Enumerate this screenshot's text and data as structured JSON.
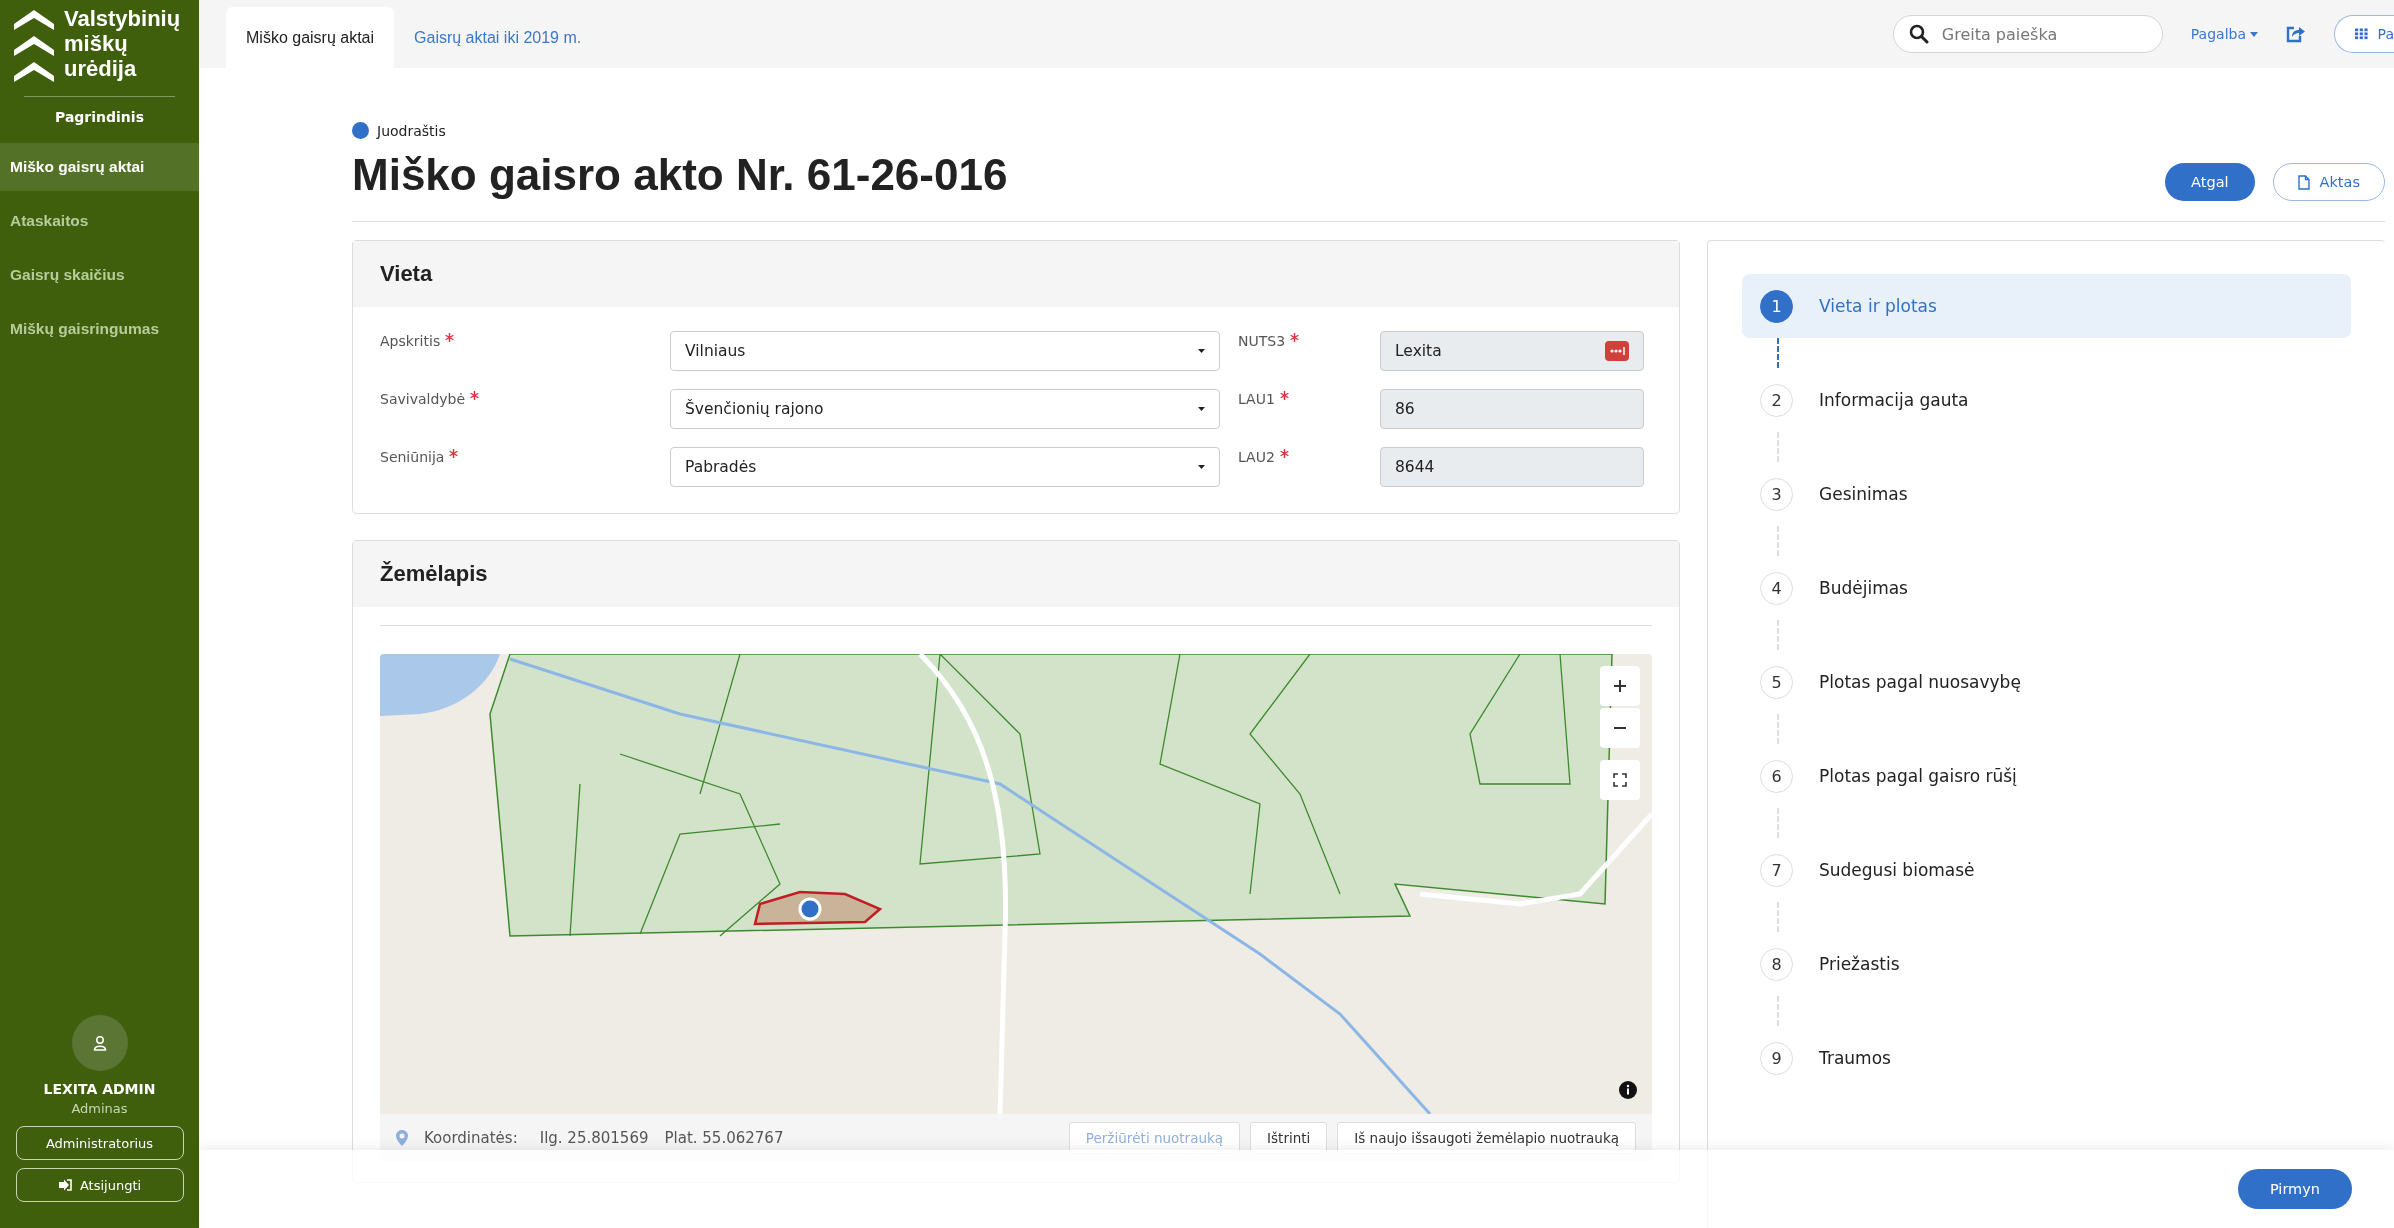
{
  "sidebar": {
    "logo_lines": [
      "Valstybinių",
      "miškų",
      "urėdija"
    ],
    "section": "Pagrindinis",
    "items": [
      {
        "label": "Miško gaisrų aktai",
        "selected": true
      },
      {
        "label": "Ataskaitos",
        "selected": false
      },
      {
        "label": "Gaisrų skaičius",
        "selected": false
      },
      {
        "label": "Miškų gaisringumas",
        "selected": false
      }
    ],
    "user": {
      "name": "LEXITA ADMIN",
      "role": "Adminas",
      "admin_button": "Administratorius",
      "logout_button": "Atsijungti"
    }
  },
  "top_tabs": [
    {
      "label": "Miško gaisrų aktai",
      "selected": true
    },
    {
      "label": "Gaisrų aktai iki 2019 m.",
      "selected": false
    }
  ],
  "search": {
    "placeholder": "Greita paieška"
  },
  "help_menu": "Pagalba",
  "apps_button": "Pa",
  "status": {
    "label": "Juodraštis",
    "color": "#3070c8"
  },
  "title": "Miško gaisro akto Nr. 61-26-016",
  "actions": {
    "back": "Atgal",
    "document": "Aktas"
  },
  "location_card": {
    "title": "Vieta",
    "left_fields": [
      {
        "label": "Apskritis",
        "required": true,
        "value": "Vilniaus",
        "kind": "select"
      },
      {
        "label": "Savivaldybė",
        "required": true,
        "value": "Švenčionių rajono",
        "kind": "select"
      },
      {
        "label": "Seniūnija",
        "required": true,
        "value": "Pabradės",
        "kind": "select"
      }
    ],
    "right_fields": [
      {
        "label": "NUTS3",
        "required": true,
        "value": "Lexita",
        "kind": "readonly_badge"
      },
      {
        "label": "LAU1",
        "required": true,
        "value": "86",
        "kind": "readonly"
      },
      {
        "label": "LAU2",
        "required": true,
        "value": "8644",
        "kind": "readonly"
      }
    ]
  },
  "map_card": {
    "title": "Žemėlapis",
    "coordinates": {
      "label": "Koordinatės:",
      "longitude": "Ilg. 25.801569",
      "latitude": "Plat. 55.062767"
    },
    "buttons": [
      {
        "label": "Peržiūrėti nuotrauką",
        "disabled": true
      },
      {
        "label": "Ištrinti",
        "disabled": false
      },
      {
        "label": "Iš naujo išsaugoti žemėlapio nuotrauką",
        "disabled": false
      }
    ]
  },
  "steps": [
    {
      "number": "1",
      "label": "Vieta ir plotas",
      "selected": true
    },
    {
      "number": "2",
      "label": "Informacija gauta",
      "selected": false
    },
    {
      "number": "3",
      "label": "Gesinimas",
      "selected": false
    },
    {
      "number": "4",
      "label": "Budėjimas",
      "selected": false
    },
    {
      "number": "5",
      "label": "Plotas pagal nuosavybę",
      "selected": false
    },
    {
      "number": "6",
      "label": "Plotas pagal gaisro rūšį",
      "selected": false
    },
    {
      "number": "7",
      "label": "Sudegusi biomasė",
      "selected": false
    },
    {
      "number": "8",
      "label": "Priežastis",
      "selected": false
    },
    {
      "number": "9",
      "label": "Traumos",
      "selected": false
    }
  ],
  "footer": {
    "next_button": "Pirmyn"
  }
}
